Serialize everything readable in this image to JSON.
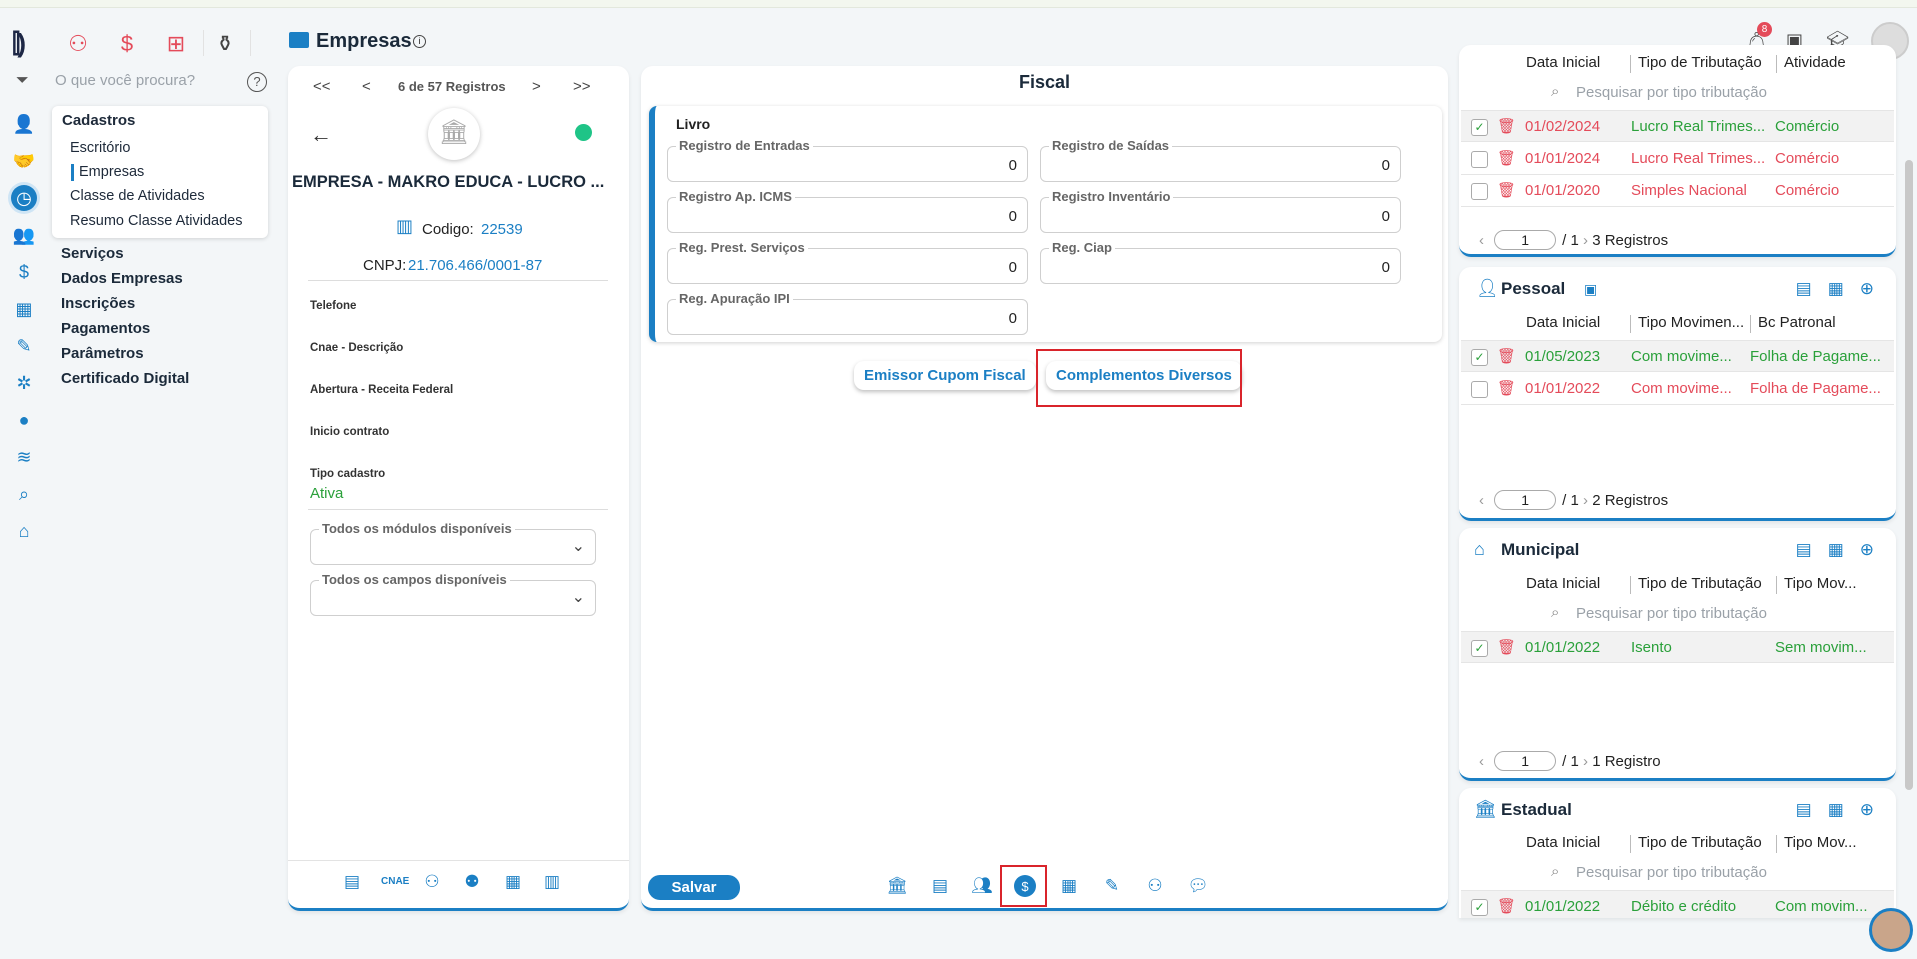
{
  "header": {
    "title": "Empresas",
    "notif_count": "8"
  },
  "search": {
    "placeholder": "O que você procura?"
  },
  "menu": {
    "group": "Cadastros",
    "items": [
      "Escritório",
      "Empresas",
      "Classe de Atividades",
      "Resumo Classe Atividades"
    ],
    "main": [
      "Serviços",
      "Dados Empresas",
      "Inscrições",
      "Pagamentos",
      "Parâmetros",
      "Certificado Digital"
    ]
  },
  "nav": {
    "first": "<<",
    "prev": "<",
    "counter": "6 de 57 Registros",
    "next": ">",
    "last": ">>"
  },
  "company": {
    "name": "EMPRESA - MAKRO EDUCA - LUCRO ...",
    "codigo_label": "Codigo:",
    "codigo": "22539",
    "cnpj_label": "CNPJ:",
    "cnpj": "21.706.466/0001-87",
    "fields": [
      "Telefone",
      "Cnae - Descrição",
      "Abertura - Receita Federal",
      "Inicio contrato"
    ],
    "tipo_label": "Tipo cadastro",
    "tipo": "Ativa",
    "modulos": "Todos os módulos disponíveis",
    "campos": "Todos os campos disponíveis",
    "cnae_btn": "CNAE"
  },
  "fiscal": {
    "title": "Fiscal",
    "section": "Livro",
    "fields": [
      {
        "label": "Registro de Entradas",
        "value": "0"
      },
      {
        "label": "Registro de Saídas",
        "value": "0"
      },
      {
        "label": "Registro Ap. ICMS",
        "value": "0"
      },
      {
        "label": "Registro Inventário",
        "value": "0"
      },
      {
        "label": "Reg. Prest. Serviços",
        "value": "0"
      },
      {
        "label": "Reg. Ciap",
        "value": "0"
      },
      {
        "label": "Reg. Apuração IPI",
        "value": "0"
      }
    ],
    "btn1": "Emissor Cupom Fiscal",
    "btn2": "Complementos Diversos",
    "save": "Salvar"
  },
  "tributacao": {
    "cols": [
      "Data Inicial",
      "Tipo de Tributação",
      "Atividade"
    ],
    "search": "Pesquisar por tipo tributação",
    "rows": [
      {
        "date": "01/02/2024",
        "tipo": "Lucro Real Trimes...",
        "ativ": "Comércio"
      },
      {
        "date": "01/01/2024",
        "tipo": "Lucro Real Trimes...",
        "ativ": "Comércio"
      },
      {
        "date": "01/01/2020",
        "tipo": "Simples Nacional",
        "ativ": "Comércio"
      }
    ],
    "page": "1",
    "total": "/ 1",
    "count": "3 Registros"
  },
  "pessoal": {
    "title": "Pessoal",
    "cols": [
      "Data Inicial",
      "Tipo Movimen...",
      "Bc Patronal"
    ],
    "rows": [
      {
        "date": "01/05/2023",
        "tipo": "Com movime...",
        "bc": "Folha de Pagame..."
      },
      {
        "date": "01/01/2022",
        "tipo": "Com movime...",
        "bc": "Folha de Pagame..."
      }
    ],
    "page": "1",
    "total": "/ 1",
    "count": "2 Registros"
  },
  "municipal": {
    "title": "Municipal",
    "cols": [
      "Data Inicial",
      "Tipo de Tributação",
      "Tipo Mov..."
    ],
    "search": "Pesquisar por tipo tributação",
    "rows": [
      {
        "date": "01/01/2022",
        "tipo": "Isento",
        "mov": "Sem movim..."
      }
    ],
    "page": "1",
    "total": "/ 1",
    "count": "1 Registro"
  },
  "estadual": {
    "title": "Estadual",
    "cols": [
      "Data Inicial",
      "Tipo de Tributação",
      "Tipo Mov..."
    ],
    "search": "Pesquisar por tipo tributação",
    "rows": [
      {
        "date": "01/01/2022",
        "tipo": "Débito e crédito",
        "mov": "Com movim..."
      }
    ]
  },
  "colors": {
    "accent": "#1b7fc4",
    "green": "#2aa03a",
    "red": "#e44b5a"
  }
}
